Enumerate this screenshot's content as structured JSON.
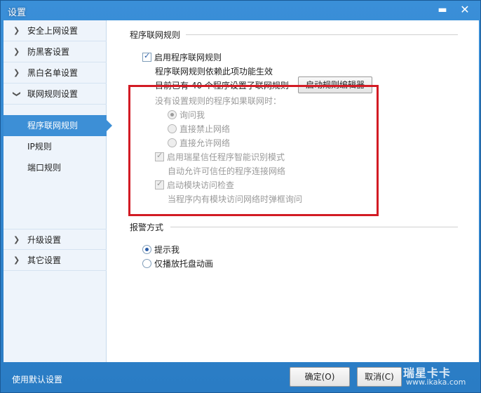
{
  "window": {
    "title": "设置",
    "minimize_glyph": "▬",
    "close_glyph": "✕"
  },
  "sidebar": {
    "groups_top": [
      {
        "label": "安全上网设置"
      },
      {
        "label": "防黑客设置"
      },
      {
        "label": "黑白名单设置"
      },
      {
        "label": "联网规则设置"
      }
    ],
    "subitems": [
      {
        "label": "程序联网规则",
        "active": true
      },
      {
        "label": "IP规则"
      },
      {
        "label": "端口规则"
      }
    ],
    "groups_bottom": [
      {
        "label": "升级设置"
      },
      {
        "label": "其它设置"
      }
    ]
  },
  "content": {
    "section1_title": "程序联网规则",
    "enable_rules_label": "启用程序联网规则",
    "enable_rules_hint": "程序联网规则依赖此项功能生效",
    "rule_count_text": "目前已有 40 个程序设置了联网规则",
    "open_editor_button": "启动规则编辑器",
    "no_rule_prompt": "没有设置规则的程序如果联网时：",
    "radio_ask": "询问我",
    "radio_block": "直接禁止网络",
    "radio_allow": "直接允许网络",
    "smart_mode_label": "启用瑞星信任程序智能识别模式",
    "smart_mode_hint": "自动允许可信任的程序连接网络",
    "module_check_label": "启动模块访问检查",
    "module_check_hint": "当程序内有模块访问网络时弹框询问",
    "section2_title": "报警方式",
    "alarm_notify": "提示我",
    "alarm_tray": "仅播放托盘动画"
  },
  "footer": {
    "default_link": "使用默认设置",
    "ok_button": "确定(O)",
    "cancel_button": "取消(C)"
  },
  "watermark": {
    "title": "瑞星卡卡",
    "url": "www.ikaka.com"
  },
  "colors": {
    "frame": "#2a7cc4",
    "active_item": "#3d8fd6",
    "highlight_box": "#d21b24"
  }
}
